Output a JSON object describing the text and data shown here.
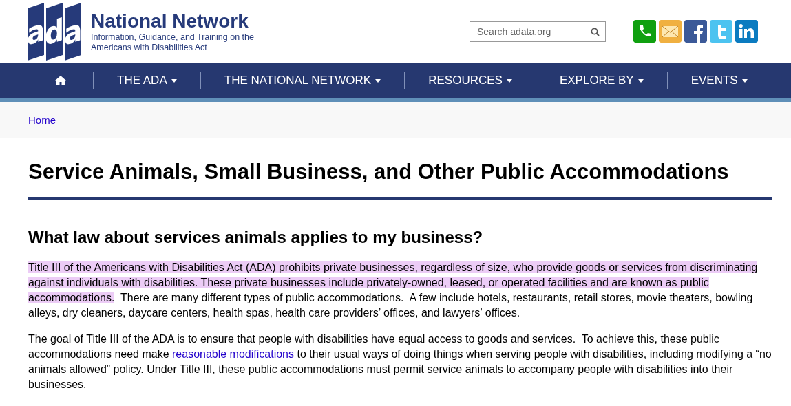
{
  "header": {
    "logo_letters": "ada",
    "title": "National Network",
    "subtitle_lines": [
      "Information, Guidance, and Training on the",
      "Americans with Disabilities Act"
    ],
    "search": {
      "placeholder": "Search adata.org"
    },
    "social": [
      {
        "kind": "phone"
      },
      {
        "kind": "mail"
      },
      {
        "kind": "facebook"
      },
      {
        "kind": "twitter"
      },
      {
        "kind": "linkedin"
      }
    ]
  },
  "nav": {
    "items": [
      {
        "kind": "home"
      },
      {
        "kind": "menu",
        "label": "THE ADA"
      },
      {
        "kind": "menu",
        "label": "THE NATIONAL NETWORK"
      },
      {
        "kind": "menu",
        "label": "RESOURCES"
      },
      {
        "kind": "menu",
        "label": "EXPLORE BY"
      },
      {
        "kind": "menu",
        "label": "EVENTS"
      }
    ]
  },
  "breadcrumb": [
    "Home"
  ],
  "page_title": "Service Animals, Small Business, and Other Public Accommodations",
  "section_heading": "What law about services animals applies to my business?",
  "paragraphs": [
    [
      {
        "kind": "highlight",
        "text": "Title III of the Americans with Disabilities Act (ADA) prohibits private businesses, regardless of size, who provide goods or services from discriminating against individuals with disabilities. These private businesses include privately-owned, leased, or operated facilities and are known as public accommodations."
      },
      {
        "kind": "plain",
        "text": "  There are many different types of public accommodations.  A few include hotels, restaurants, retail stores, movie theaters, bowling alleys, dry cleaners, daycare centers, health spas, health care providers’ offices, and lawyers’ offices."
      }
    ],
    [
      {
        "kind": "plain",
        "text": "The goal of Title III of the ADA is to ensure that people with disabilities have equal access to goods and services.  To achieve this, these public accommodations need make "
      },
      {
        "kind": "link",
        "text": "reasonable modifications"
      },
      {
        "kind": "plain",
        "text": " to their usual ways of doing things when serving people with disabilities, including modifying a “no animals allowed” policy. Under Title III, these public accommodations must permit service animals to accompany people with disabilities into their businesses."
      }
    ]
  ]
}
